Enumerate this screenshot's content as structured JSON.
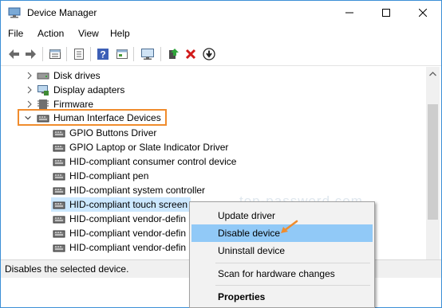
{
  "window": {
    "title": "Device Manager",
    "accent": "#3c8fd6"
  },
  "menu": {
    "items": [
      "File",
      "Action",
      "View",
      "Help"
    ]
  },
  "toolbar": {
    "icons": [
      "back-icon",
      "forward-icon",
      "properties-icon",
      "list-icon",
      "help-icon",
      "show-hidden-icon",
      "monitor-icon",
      "update-driver-icon",
      "uninstall-icon",
      "disable-icon"
    ]
  },
  "tree": {
    "categories": [
      {
        "label": "Disk drives",
        "expanded": false
      },
      {
        "label": "Display adapters",
        "expanded": false
      },
      {
        "label": "Firmware",
        "expanded": false
      },
      {
        "label": "Human Interface Devices",
        "expanded": true,
        "highlight_color": "#f08c2d"
      }
    ],
    "children": [
      "GPIO Buttons Driver",
      "GPIO Laptop or Slate Indicator Driver",
      "HID-compliant consumer control device",
      "HID-compliant pen",
      "HID-compliant system controller",
      "HID-compliant touch screen",
      "HID-compliant vendor-defin",
      "HID-compliant vendor-defin",
      "HID-compliant vendor-defin"
    ],
    "selected_child_index": 5
  },
  "context_menu": {
    "items": [
      "Update driver",
      "Disable device",
      "Uninstall device",
      "Scan for hardware changes",
      "Properties"
    ],
    "active_index": 1,
    "active_color": "#91c9f7"
  },
  "status": {
    "text": "Disables the selected device."
  },
  "watermark": "top-password.com"
}
